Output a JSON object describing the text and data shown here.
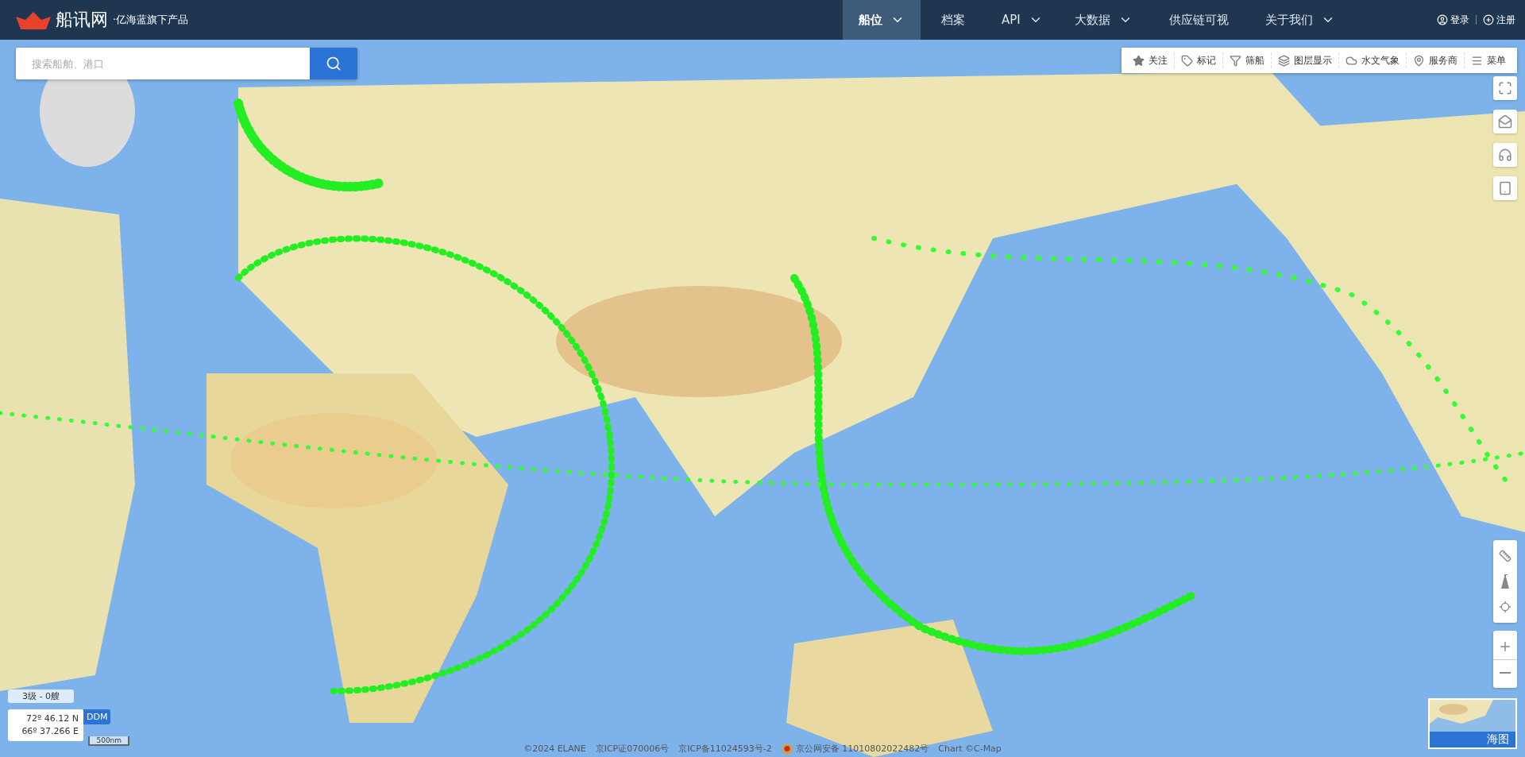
{
  "logo": {
    "name": "船讯网",
    "tagline": "·亿海蓝旗下产品"
  },
  "nav": [
    {
      "label": "船位",
      "dropdown": true,
      "selected": true
    },
    {
      "label": "档案",
      "dropdown": false,
      "selected": false
    },
    {
      "label": "API",
      "dropdown": true,
      "selected": false
    },
    {
      "label": "大数据",
      "dropdown": true,
      "selected": false
    },
    {
      "label": "供应链可视",
      "dropdown": false,
      "selected": false
    },
    {
      "label": "关于我们",
      "dropdown": true,
      "selected": false
    }
  ],
  "auth": [
    {
      "label": "登录",
      "kind": "login"
    },
    {
      "label": "注册",
      "kind": "register"
    }
  ],
  "search": {
    "placeholder": "搜索船舶、港口"
  },
  "toolbar": [
    {
      "label": "关注",
      "kind": "star"
    },
    {
      "label": "标记",
      "kind": "tag"
    },
    {
      "label": "筛船",
      "kind": "filter"
    },
    {
      "label": "图层显示",
      "kind": "layers"
    },
    {
      "label": "水文气象",
      "kind": "weather"
    },
    {
      "label": "服务商",
      "kind": "pin"
    },
    {
      "label": "菜单",
      "kind": "menu"
    }
  ],
  "status": {
    "level": "3级 - 0艘",
    "latitude": "72º 46.12 N",
    "longitude": "66º 37.266 E",
    "format": "DDM",
    "scale": "500nm"
  },
  "map_type": {
    "label": "海图"
  },
  "footer": [
    {
      "text": "©2024 ELANE",
      "kind": "text"
    },
    {
      "text": "京ICP证070006号",
      "kind": "text"
    },
    {
      "text": "京ICP备11024593号-2",
      "kind": "text"
    },
    {
      "text": "京公网安备 11010802022482号",
      "kind": "badge"
    },
    {
      "text": "Chart ©C-Map",
      "kind": "text"
    }
  ]
}
